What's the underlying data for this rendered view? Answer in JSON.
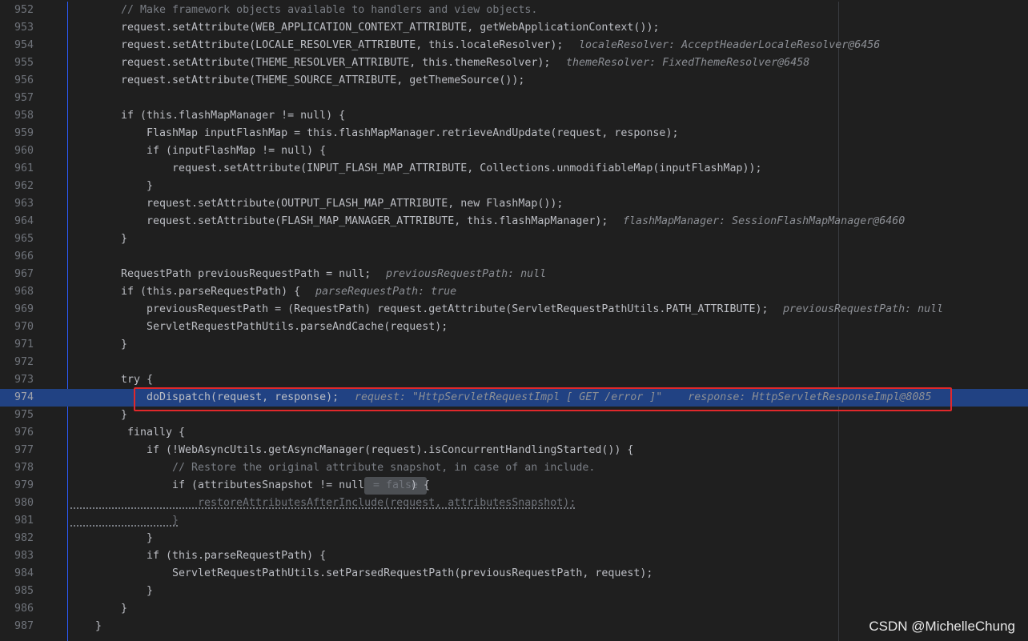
{
  "editor": {
    "lines": [
      {
        "n": "952",
        "code": "// Make framework objects available to handlers and view objects."
      },
      {
        "n": "953",
        "code": "request.setAttribute(WEB_APPLICATION_CONTEXT_ATTRIBUTE, getWebApplicationContext());"
      },
      {
        "n": "954",
        "code": "request.setAttribute(LOCALE_RESOLVER_ATTRIBUTE, this.localeResolver);",
        "hint": "localeResolver: AcceptHeaderLocaleResolver@6456"
      },
      {
        "n": "955",
        "code": "request.setAttribute(THEME_RESOLVER_ATTRIBUTE, this.themeResolver);",
        "hint": "themeResolver: FixedThemeResolver@6458"
      },
      {
        "n": "956",
        "code": "request.setAttribute(THEME_SOURCE_ATTRIBUTE, getThemeSource());"
      },
      {
        "n": "957",
        "code": ""
      },
      {
        "n": "958",
        "code": "if (this.flashMapManager != null) {"
      },
      {
        "n": "959",
        "code": "FlashMap inputFlashMap = this.flashMapManager.retrieveAndUpdate(request, response);"
      },
      {
        "n": "960",
        "code": "if (inputFlashMap != null) {"
      },
      {
        "n": "961",
        "code": "request.setAttribute(INPUT_FLASH_MAP_ATTRIBUTE, Collections.unmodifiableMap(inputFlashMap));"
      },
      {
        "n": "962",
        "code": "}"
      },
      {
        "n": "963",
        "code": "request.setAttribute(OUTPUT_FLASH_MAP_ATTRIBUTE, new FlashMap());"
      },
      {
        "n": "964",
        "code": "request.setAttribute(FLASH_MAP_MANAGER_ATTRIBUTE, this.flashMapManager);",
        "hint": "flashMapManager: SessionFlashMapManager@6460"
      },
      {
        "n": "965",
        "code": "}"
      },
      {
        "n": "966",
        "code": ""
      },
      {
        "n": "967",
        "code": "RequestPath previousRequestPath = null;",
        "hint": "previousRequestPath: null"
      },
      {
        "n": "968",
        "code": "if (this.parseRequestPath) {",
        "hint": "parseRequestPath: true"
      },
      {
        "n": "969",
        "code": "previousRequestPath = (RequestPath) request.getAttribute(ServletRequestPathUtils.PATH_ATTRIBUTE);",
        "hint": "previousRequestPath: null"
      },
      {
        "n": "970",
        "code": "ServletRequestPathUtils.parseAndCache(request);"
      },
      {
        "n": "971",
        "code": "}"
      },
      {
        "n": "972",
        "code": ""
      },
      {
        "n": "973",
        "code": "try {"
      },
      {
        "n": "974",
        "code": "doDispatch(request, response);",
        "hint": "request: \"HttpServletRequestImpl [ GET /error ]\"    response: HttpServletResponseImpl@8085"
      },
      {
        "n": "975",
        "code": "}"
      },
      {
        "n": "976",
        "code": "finally {"
      },
      {
        "n": "977",
        "code": "if (!WebAsyncUtils.getAsyncManager(request).isConcurrentHandlingStarted()) {"
      },
      {
        "n": "978",
        "code": "// Restore the original attribute snapshot, in case of an include."
      },
      {
        "n": "979",
        "code": "if (attributesSnapshot != null",
        "pill": " = false ",
        "tail": ") {"
      },
      {
        "n": "980",
        "code": "restoreAttributesAfterInclude(request, attributesSnapshot);"
      },
      {
        "n": "981",
        "code": "}"
      },
      {
        "n": "982",
        "code": "}"
      },
      {
        "n": "983",
        "code": "if (this.parseRequestPath) {"
      },
      {
        "n": "984",
        "code": "ServletRequestPathUtils.setParsedRequestPath(previousRequestPath, request);"
      },
      {
        "n": "985",
        "code": "}"
      },
      {
        "n": "986",
        "code": "}"
      },
      {
        "n": "987",
        "code": "}"
      }
    ]
  },
  "watermark": "CSDN @MichelleChung",
  "colors": {
    "current_line": "#214283",
    "highlight_box": "#e0282b",
    "background": "#1f1f1f"
  }
}
